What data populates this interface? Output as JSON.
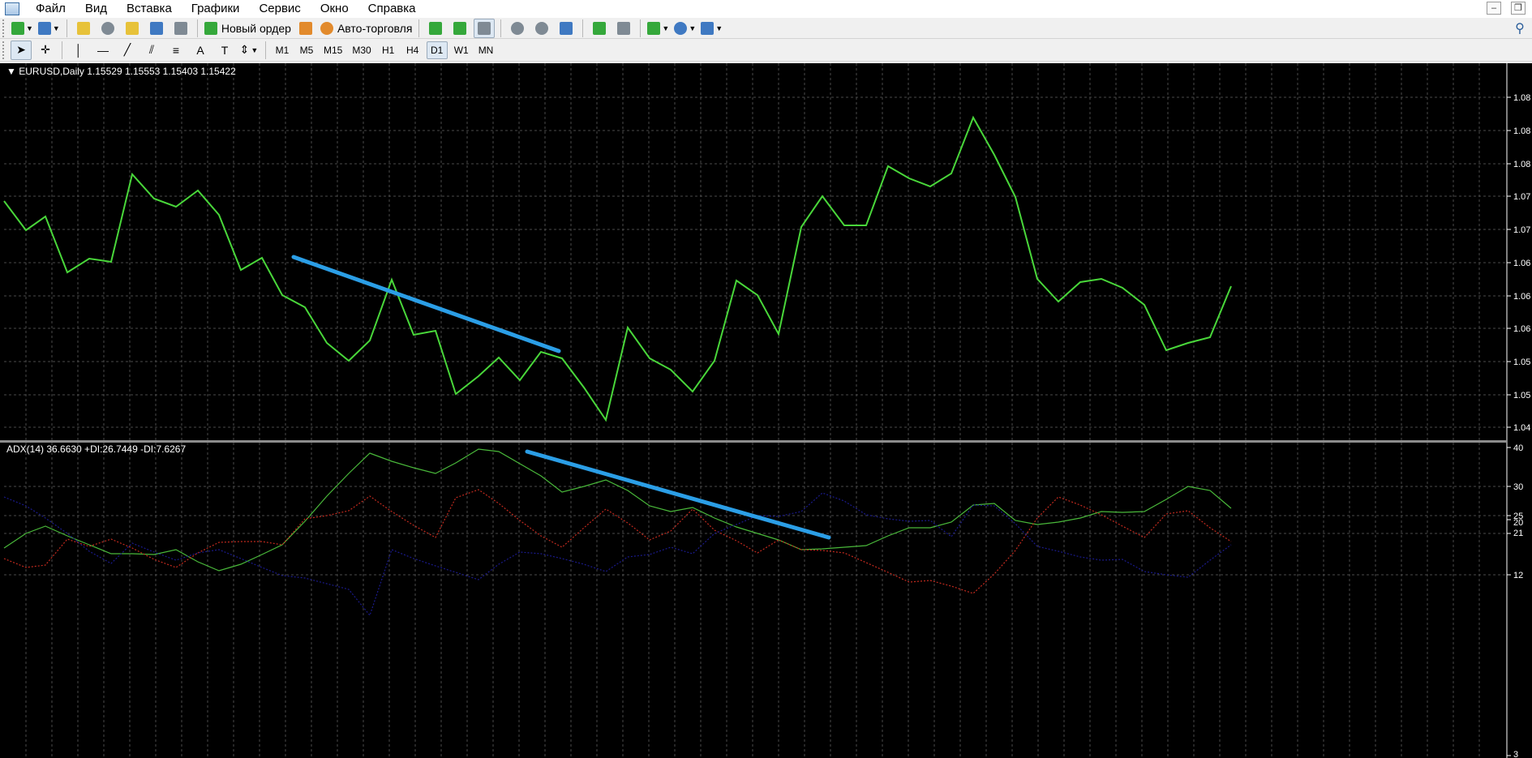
{
  "menu": {
    "items": [
      "Файл",
      "Вид",
      "Вставка",
      "Графики",
      "Сервис",
      "Окно",
      "Справка"
    ]
  },
  "toolbar": {
    "new_order_label": "Новый ордер",
    "autotrading_label": "Авто-торговля",
    "timeframes": [
      "M1",
      "M5",
      "M15",
      "M30",
      "H1",
      "H4",
      "D1",
      "W1",
      "MN"
    ],
    "active_timeframe": "D1"
  },
  "main_chart": {
    "header": "EURUSD,Daily  1.15529 1.15553 1.15403 1.15422",
    "price_labels": [
      "1.08",
      "1.08",
      "1.08",
      "1.07",
      "1.07",
      "1.06",
      "1.06",
      "1.06",
      "1.05",
      "1.05",
      "1.04"
    ],
    "line_color": "#49d73a",
    "annotation_color": "#2b9ee6"
  },
  "adx_panel": {
    "header": "ADX(14) 36.6630 +DI:26.7449 -DI:7.6267",
    "level_labels": [
      "40",
      "30",
      "25",
      "21",
      "20",
      "12",
      "3"
    ],
    "adx_color": "#49b83a",
    "plus_di_color": "#c22a1e",
    "minus_di_color": "#1a1a8c"
  }
}
